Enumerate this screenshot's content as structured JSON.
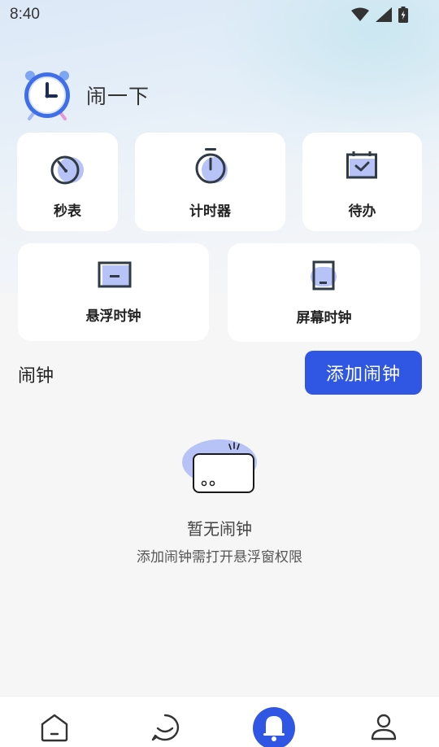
{
  "status_bar": {
    "time": "8:40"
  },
  "app": {
    "name": "闹一下"
  },
  "tools": [
    {
      "label": "秒表",
      "icon": "stopwatch-icon"
    },
    {
      "label": "计时器",
      "icon": "timer-icon"
    },
    {
      "label": "待办",
      "icon": "calendar-check-icon"
    },
    {
      "label": "悬浮时钟",
      "icon": "floating-clock-icon"
    },
    {
      "label": "屏幕时钟",
      "icon": "screen-clock-icon"
    }
  ],
  "alarm_section": {
    "title": "闹钟",
    "add_button": "添加闹钟"
  },
  "empty_state": {
    "title": "暂无闹钟",
    "subtitle": "添加闹钟需打开悬浮窗权限"
  },
  "bottom_nav": [
    {
      "name": "home",
      "icon": "home-icon",
      "active": false
    },
    {
      "name": "chat",
      "icon": "chat-icon",
      "active": false
    },
    {
      "name": "alarm",
      "icon": "bell-icon",
      "active": true
    },
    {
      "name": "profile",
      "icon": "person-icon",
      "active": false
    }
  ],
  "colors": {
    "accent": "#3057e4",
    "icon_highlight": "#b7c3f7",
    "background": "#f6f6f7"
  }
}
